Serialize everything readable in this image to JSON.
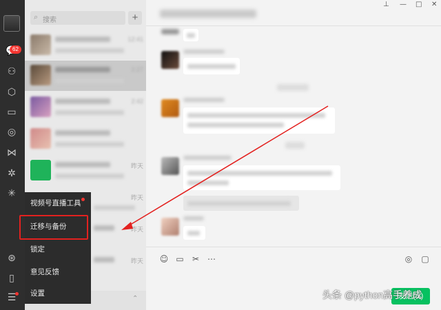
{
  "nav": {
    "unread_badge": "62",
    "icons": [
      "chat-icon",
      "contacts-icon",
      "box-icon",
      "folder-icon",
      "moments-icon",
      "channels-icon",
      "miniprogram-icon",
      "search-icon",
      "pin-icon",
      "phone-icon",
      "menu-icon"
    ]
  },
  "search": {
    "placeholder": "搜索",
    "add_label": "+"
  },
  "chats": {
    "times": [
      "12:41",
      "2:27",
      "2:42",
      "昨天",
      "昨天",
      "昨天",
      "昨天"
    ]
  },
  "window": {
    "pin": "⊥",
    "minimize": "—",
    "maximize": "□",
    "close": "✕"
  },
  "menu": {
    "items": [
      "视频号直播工具",
      "迁移与备份",
      "锁定",
      "意见反馈",
      "设置"
    ]
  },
  "composer": {
    "send_label": "发送(S)"
  },
  "watermark": "头条 @python高手养成",
  "colors": {
    "accent": "#07c160",
    "badge": "#f43530",
    "annotation": "#e3211f"
  }
}
